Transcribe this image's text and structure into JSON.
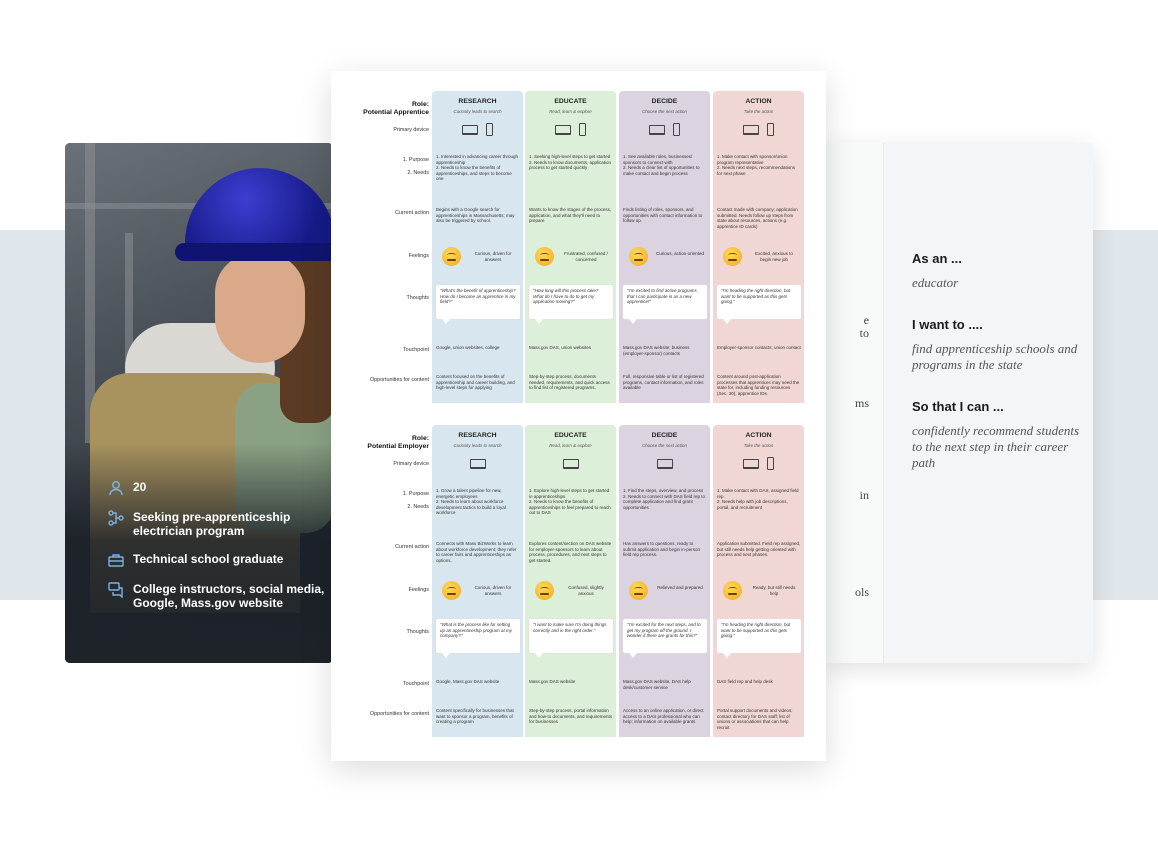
{
  "persona": {
    "age": "20",
    "goal": "Seeking pre-apprenticeship electrician program",
    "education": "Technical school graduate",
    "sources": "College instructors, social media, Google, Mass.gov website",
    "icons": [
      "person-icon",
      "workflow-icon",
      "toolbox-icon",
      "chat-icon"
    ]
  },
  "story": {
    "as_an": "As an ...",
    "role": "educator",
    "i_want": "I want to ....",
    "want": "find apprenticeship schools and programs in the state",
    "so_that": "So that I can ...",
    "benefit": "confidently recommend students to the next step in their career path",
    "edge_fragments": [
      "e",
      "to",
      "ms",
      "in",
      "ols"
    ]
  },
  "colors": {
    "research": "#d8e6ef",
    "educate": "#dcefd8",
    "decide": "#dbd4e0",
    "action": "#f1d7d3"
  },
  "maps": [
    {
      "role": "Role:\nPotential Apprentice",
      "stages": [
        {
          "title": "RESEARCH",
          "sub": "Curiosity leads to search",
          "devices": [
            "laptop",
            "phone"
          ],
          "purpose": "1. Interested in advancing career through apprenticeship\n2. Needs to know the benefits of apprenticeships, and steps to become one",
          "action": "Begins with a Google search for apprenticeships in Massachusetts; may also be triggered by school.",
          "feeling": "Curious, driven for answers",
          "thought": "\"What's the benefit of apprenticeship? How do I become an apprentice in my field?\"",
          "touchpoint": "Google, union websites, college",
          "opportunity": "Content focused on the benefits of apprenticeship and career building, and high-level steps for applying"
        },
        {
          "title": "EDUCATE",
          "sub": "Read, learn & explore",
          "devices": [
            "laptop",
            "phone"
          ],
          "purpose": "1. Seeking high-level steps to get started\n2. Needs to know documents, application process to get started quickly",
          "action": "Wants to know the stages of the process, application, and what they'll need to prepare",
          "feeling": "Frustrated, confused / concerned",
          "thought": "\"How long will this process take? What do I have to do to get my application moving?\"",
          "touchpoint": "Mass.gov DAS, union websites",
          "opportunity": "Step-by-step process, documents needed, requirements, and quick access to find list of registered programs."
        },
        {
          "title": "DECIDE",
          "sub": "Choose the next action",
          "devices": [
            "laptop",
            "phone"
          ],
          "purpose": "1. See available roles, businesses/ sponsors to connect with\n2. Needs a clear list of opportunities to make contact and begin process",
          "action": "Finds listing of roles, sponsors, and opportunities with contact information to follow up.",
          "feeling": "Curious, action-oriented",
          "thought": "\"I'm excited to find active programs that I can participate in as a new apprentice!\"",
          "touchpoint": "Mass.gov DAS website; business (employer-sponsor) contacts",
          "opportunity": "Full, responsive table or list of registered programs, contact information, and roles available"
        },
        {
          "title": "ACTION",
          "sub": "Take the action",
          "devices": [
            "laptop",
            "phone"
          ],
          "purpose": "1. Make contact with sponsor/union program representative\n2. Needs next steps, recommendations for next phase",
          "action": "Contact made with company; application submitted. Needs follow up steps from state about resources, actions (e.g. apprentice ID cards)",
          "feeling": "Excited, anxious to begin new job",
          "thought": "\"I'm heading the right direction, but want to be supported as this gets going.\"",
          "touchpoint": "Employer-sponsor contacts; union contact",
          "opportunity": "Content around post-application processes that apprentices may need the state for, including funding resources (Sec. 30), apprentice IDs."
        }
      ]
    },
    {
      "role": "Role:\nPotential Employer",
      "stages": [
        {
          "title": "RESEARCH",
          "sub": "Curiosity leads to search",
          "devices": [
            "laptop"
          ],
          "purpose": "1. Grow a talent pipeline for new, energetic employees\n2. Needs to learn about workforce development tactics to build a loyal workforce",
          "action": "Connects with Mass BizWorks to learn about workforce development; they refer to career fairs and apprenticeships as options.",
          "feeling": "Curious, driven for answers",
          "thought": "\"What is the process like for setting up an apprenticeship program at my company?\"",
          "touchpoint": "Google, Mass.gov DAS website",
          "opportunity": "Content specifically for businesses that want to sponsor a program, benefits of creating a program"
        },
        {
          "title": "EDUCATE",
          "sub": "Read, learn & explore",
          "devices": [
            "laptop"
          ],
          "purpose": "1. Explore high-level steps to get started in apprenticeships\n2. Needs to know the benefits of apprenticeships to feel prepared to reach out to DAS",
          "action": "Explores content/section on DAS website for employer-sponsors to learn about process, procedures, and next steps to get started.",
          "feeling": "Confused, slightly anxious",
          "thought": "\"I want to make sure I'm doing things correctly and in the right order.\"",
          "touchpoint": "Mass.gov DAS website",
          "opportunity": "Step-by-step process, portal information and how-to documents, and requirements for businesses"
        },
        {
          "title": "DECIDE",
          "sub": "Choose the next action",
          "devices": [
            "laptop"
          ],
          "purpose": "1. Find the steps, overview, and process\n2. Needs to connect with DAS field rep to complete application and find grant opportunities",
          "action": "Has answers to questions, ready to submit application and begin in-person field rep process.",
          "feeling": "Relieved and prepared",
          "thought": "\"I'm excited for the next steps, and to get my program off the ground. I wonder if there are grants for this?\"",
          "touchpoint": "Mass.gov DAS website, DAS help desk/customer service",
          "opportunity": "Access to an online application, or direct access to a DAS professional who can help; information on available grants"
        },
        {
          "title": "ACTION",
          "sub": "Take the action",
          "devices": [
            "laptop",
            "phone"
          ],
          "purpose": "1. Make contact with DAS, assigned field rep\n2. Needs help with job descriptions, portal, and recruitment",
          "action": "Application submitted. Field rep assigned, but still needs help getting oriented with process and next phases.",
          "feeling": "Ready, but still needs help",
          "thought": "\"I'm heading the right direction, but want to be supported as this gets going.\"",
          "touchpoint": "DAS field rep and help desk",
          "opportunity": "Portal support documents and videos; contact directory for DAS staff; list of unions or associations that can help recruit"
        }
      ]
    }
  ],
  "row_labels": {
    "device": "Primary device",
    "purpose": "1.  Purpose",
    "needs": "2.  Needs",
    "action": "Current action",
    "feelings": "Feelings",
    "thoughts": "Thoughts",
    "touchpoint": "Touchpoint",
    "opportunities": "Opportunities for content"
  }
}
